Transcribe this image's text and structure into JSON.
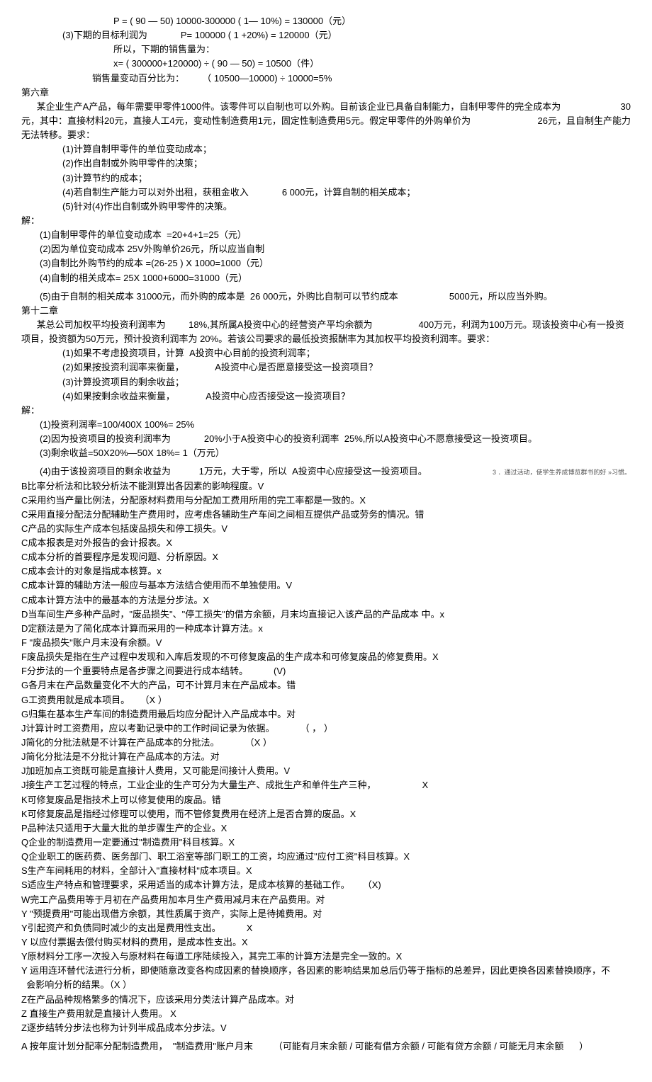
{
  "l1": "P = ( 90 — 50) 10000-300000 ( 1— 10%) = 130000（元）",
  "l2": "(3)下期的目标利润为             P= 100000 ( 1 +20%) = 120000（元）",
  "l3": "所以，下期的销售量为：",
  "l4": "x= ( 300000+120000) ÷ ( 90 — 50) = 10500（件）",
  "l5": "销售量变动百分比为：       （ 10500—10000) ÷ 10000=5%",
  "l6": "第六章",
  "l7a": "      某企业生产A产品，每年需要甲零件1000件。该零件可以自制也可以外购。目前该企业已具备自制能力，自制甲零件的完全成本为",
  "l7b": "30",
  "l8a": "元，其中：直接材料20元，直接人工4元，变动性制造费用1元，固定性制造费用5元。假定甲零件的外购单价为",
  "l8b": "26元，且自制生产能力",
  "l9": "无法转移。要求：",
  "l10": "(1)计算自制甲零件的单位变动成本；",
  "l11": "(2)作出自制或外购甲零件的决策；",
  "l12": "(3)计算节约的成本；",
  "l13": "(4)若自制生产能力可以对外出租，获租金收入             6 000元，计算自制的相关成本；",
  "l14": "(5)针对(4)作出自制或外购甲零件的决策。",
  "l15": "解：",
  "l16": "(1)自制甲零件的单位变动成本  =20+4+1=25（元）",
  "l17": "(2)因为单位变动成本 25V外购单价26元，所以应当自制",
  "l18": "(3)自制比外购节约的成本 =(26-25 ) X 1000=1000（元）",
  "l19": "(4)自制的相关成本= 25X 1000+6000=31000（元）",
  "l20": "(5)由于自制的相关成本 31000元，而外购的成本是  26 000元，外购比自制可以节约成本                    5000元，所以应当外购。",
  "l21": "第十二章",
  "l22": "      某总公司加权平均投资利润率为         18%,其所属A投资中心的经营资产平均余额为                  400万元，利润为100万元。现该投资中心有一投资",
  "l23": "项目，投资额为50万元，预计投资利润率为 20%。若该公司要求的最低投资报酬率为其加权平均投资利润率。要求：",
  "l24": "(1)如果不考虑投资项目，计算  A投资中心目前的投资利润率；",
  "l25": "(2)如果按投资利润率来衡量，            A投资中心是否愿意接受这一投资项目？",
  "l26": "(3)计算投资项目的剩余收益；",
  "l27": "(4)如果按剩余收益来衡量，            A投资中心应否接受这一投资项目？",
  "l28": "解：",
  "l29": "(1)投资利润率=100/400X 100%= 25%",
  "l30": "(2)因为投资项目的投资利润率为             20%小于A投资中心的投资利润率  25%,所以A投资中心不愿意接受这一投资项目。",
  "l31": "(3)剩余收益=50X20%—50X 18%= 1（万元）",
  "l32": "(4)由于该投资项目的剩余收益为           1万元，大于零，所以  A投资中心应接受这一投资项目。",
  "l32fn": "3 ．通过活动，使学生养成博览群书的好 »习惯。",
  "l33": "B比率分析法和比较分析法不能测算出各因素的影响程度。V",
  "l34": "C采用约当产量比例法，分配原材料费用与分配加工费用所用的完工率都是一致的。X",
  "l35": "C采用直接分配法分配辅助生产费用时，应考虑各辅助生产车间之间相互提供产品或劳务的情况。错",
  "l36": "C产品的实际生产成本包括废品损失和停工损失。V",
  "l37": "C成本报表是对外报告的会计报表。X",
  "l38": "C成本分析的首要程序是发现问题、分析原因。X",
  "l39": "C成本会计的对象是指成本核算。x",
  "l40": "C成本计算的辅助方法一般应与基本方法结合使用而不单独使用。V",
  "l41": "C成本计算方法中的最基本的方法是分步法。X",
  "l42": "D当车间生产多种产品时，\"废品损失\"、\"停工损失\"的借方余额，月末均直接记入该产品的产品成本 中。x",
  "l43": "D定额法是为了简化成本计算而采用的一种成本计算方法。x",
  "l44": "F \"废品损失\"账户月末没有余额。V",
  "l45": "F废品损失是指在生产过程中发现和入库后发现的不可修复废品的生产成本和可修复废品的修复费用。X",
  "l46": "F分步法的一个重要特点是各步骤之间要进行成本结转。          (V)",
  "l47": "G各月末在产品数量变化不大的产品，可不计算月末在产品成本。错",
  "l48": "G工资费用就是成本项目。    （X ）",
  "l49": "G归集在基本生产车间的制造费用最后均应分配计入产品成本中。对",
  "l50": "J计算计时工资费用，应以考勤记录中的工作时间记录为依据。          （ ， ）",
  "l51": "J简化的分批法就是不计算在产品成本的分批法。          （X ）",
  "l52": "J简化分批法是不分批计算在产品成本的方法。对",
  "l53": "J加班加点工资既可能是直接计人费用，又可能是间接计人费用。V",
  "l54": "J接生产工艺过程的特点，工业企业的生产可分为大量生产、成批生产和单件生产三种，                  X",
  "l55": "K可修复废品是指技术上可以修复使用的废品。错",
  "l56": "K可修复废品是指经过修理可以使用，而不管修复费用在经济上是否合算的废品。X",
  "l57": "P品种法只适用于大量大批的单步骤生产的企业。X",
  "l58": "Q企业的制造费用一定要通过\"制造费用\"科目核算。X",
  "l59": "Q企业职工的医药费、医务部门、职工浴室等部门职工的工资，均应通过\"应付工资\"科目核算。X",
  "l60": "S生产车间耗用的材料，全部计入\"直接材料\"成本项目。X",
  "l61": "S适应生产特点和管理要求，采用适当的成本计算方法，是成本核算的基础工作。     （X)",
  "l62": "W完工产品费用等于月初在产品费用加本月生产费用减月末在产品费用。对",
  "l63": "Y \"预提费用\"可能出现借方余额，其性质属于资产，实际上是待摊费用。对",
  "l64": "Y引起资产和负债同时减少的支出是费用性支出。          X",
  "l65": "Y 以应付票据去偿付购买材料的费用，是成本性支出。X",
  "l66": "Y原材料分工序一次投入与原材料在每道工序陆续投入，其完工率的计算方法是完全一致的。X",
  "l67": "Y 运用连环替代法进行分析，即使随意改变各构成因素的替换顺序，各因素的影响结果加总后仍等于指标的总差异，因此更换各因素替换顺序，不",
  "l68": "  会影响分析的结果。（X ）",
  "l69": "Z在产品品种规格繁多的情况下，应该采用分类法计算产品成本。对",
  "l70": "Z 直接生产费用就是直接计人费用。 X",
  "l71": "Z逐步结转分步法也称为计列半成品成本分步法。V",
  "l72": "A 按年度计划分配率分配制造费用，  \"制造费用\"账户月末        （可能有月末余额 / 可能有借方余额 / 可能有贷方余额 / 可能无月末余额      ）"
}
